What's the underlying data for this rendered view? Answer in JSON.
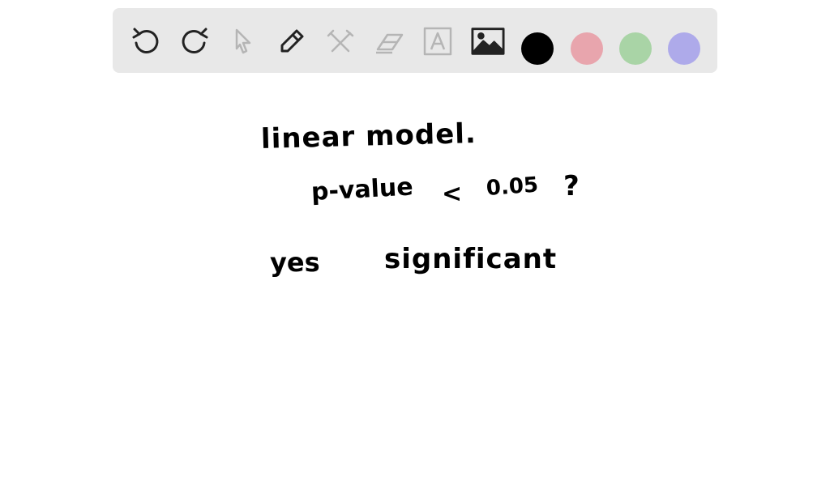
{
  "toolbar": {
    "tools": [
      "undo-icon",
      "redo-icon",
      "pointer-icon",
      "pencil-icon",
      "tools-icon",
      "eraser-icon",
      "text-icon",
      "image-icon"
    ],
    "colors": [
      "#000000",
      "#e8a5ad",
      "#a9d4a6",
      "#aeaaea"
    ]
  },
  "canvas": {
    "line1": "linear model.",
    "pvalue": "p-value",
    "lt": "<",
    "threshold": "0.05",
    "question": "?",
    "answer": "yes",
    "verdict": "significant"
  }
}
